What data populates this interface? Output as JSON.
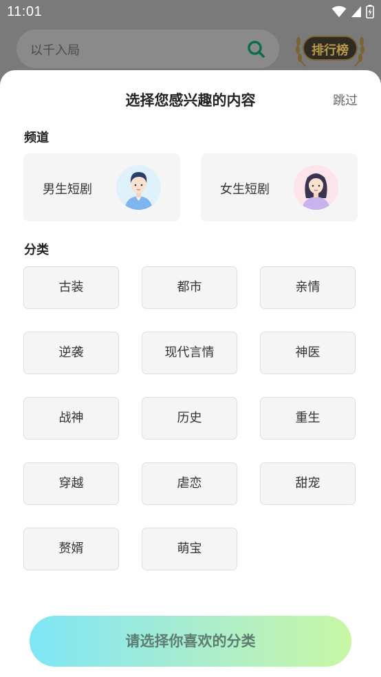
{
  "status_bar": {
    "time": "11:01"
  },
  "background": {
    "search_placeholder": "以千入局",
    "rank_label": "排行榜"
  },
  "sheet": {
    "title": "选择您感兴趣的内容",
    "skip_label": "跳过",
    "channel_section_title": "频道",
    "channels": [
      {
        "label": "男生短剧",
        "avatar": "male-avatar-icon"
      },
      {
        "label": "女生短剧",
        "avatar": "female-avatar-icon"
      }
    ],
    "category_section_title": "分类",
    "categories": [
      "古装",
      "都市",
      "亲情",
      "逆袭",
      "现代言情",
      "神医",
      "战神",
      "历史",
      "重生",
      "穿越",
      "虐恋",
      "甜宠",
      "赘婿",
      "萌宝"
    ],
    "confirm_label": "请选择你喜欢的分类"
  },
  "colors": {
    "accent_gradient_start": "#7ee6f5",
    "accent_gradient_end": "#c8f7a4",
    "search_icon": "#1aa37a"
  }
}
